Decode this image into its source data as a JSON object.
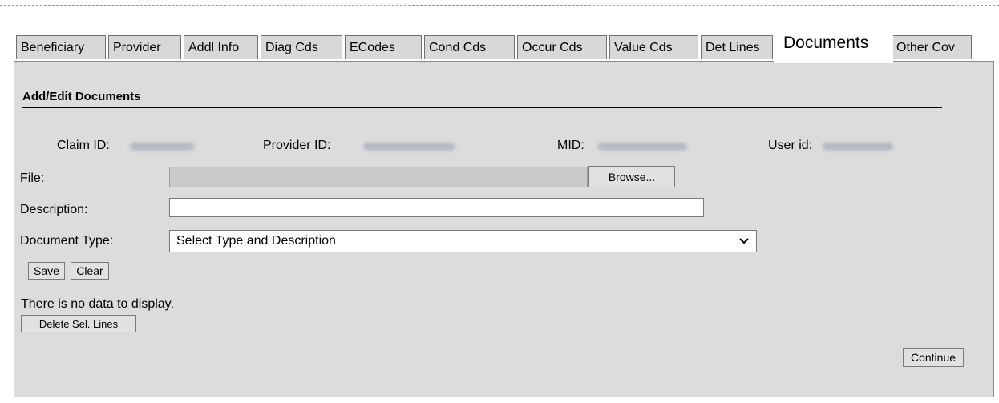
{
  "tabs": [
    {
      "label": "Beneficiary"
    },
    {
      "label": "Provider"
    },
    {
      "label": "Addl Info"
    },
    {
      "label": "Diag Cds"
    },
    {
      "label": "ECodes"
    },
    {
      "label": "Cond Cds"
    },
    {
      "label": "Occur Cds"
    },
    {
      "label": "Value Cds"
    },
    {
      "label": "Det Lines"
    },
    {
      "label": "Documents",
      "active": true
    },
    {
      "label": "Other Cov"
    }
  ],
  "section": {
    "title": "Add/Edit Documents"
  },
  "info": {
    "claim_id_label": "Claim ID:",
    "provider_id_label": "Provider ID:",
    "mid_label": "MID:",
    "user_id_label": "User id:"
  },
  "form": {
    "file_label": "File:",
    "browse_label": "Browse...",
    "description_label": "Description:",
    "description_value": "",
    "document_type_label": "Document Type:",
    "document_type_selected": "Select Type and Description",
    "save_label": "Save",
    "clear_label": "Clear"
  },
  "results": {
    "empty_message": "There is no data to display.",
    "delete_label": "Delete Sel. Lines"
  },
  "footer": {
    "continue_label": "Continue"
  },
  "icons": {
    "select_arrow": "chevron-down-icon"
  }
}
